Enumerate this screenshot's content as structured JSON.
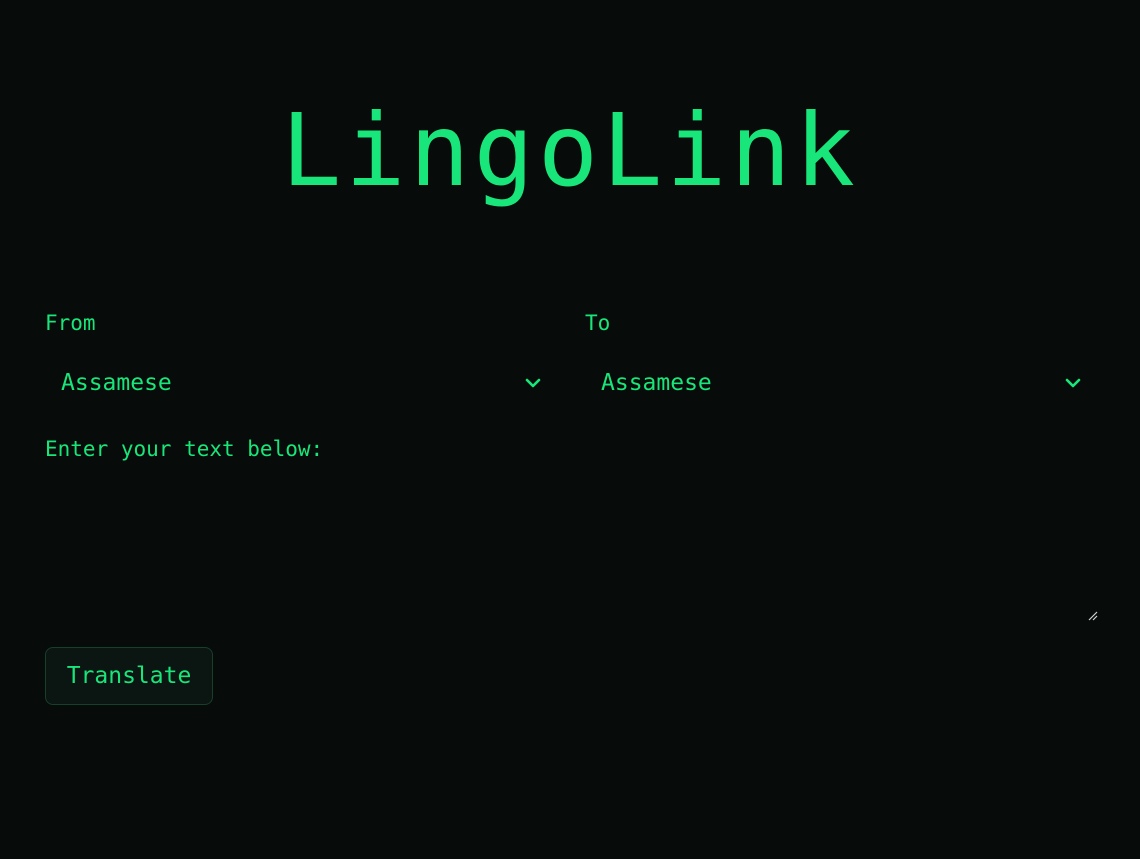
{
  "app": {
    "title": "LingoLink"
  },
  "from": {
    "label": "From",
    "selected": "Assamese"
  },
  "to": {
    "label": "To",
    "selected": "Assamese"
  },
  "input": {
    "label": "Enter your text below:",
    "value": ""
  },
  "actions": {
    "translate_label": "Translate"
  },
  "colors": {
    "background": "#070b0a",
    "accent": "#19e67a"
  },
  "icons": {
    "select_chevron": "chevron-down-icon",
    "textarea_resize": "resize-handle-icon"
  }
}
